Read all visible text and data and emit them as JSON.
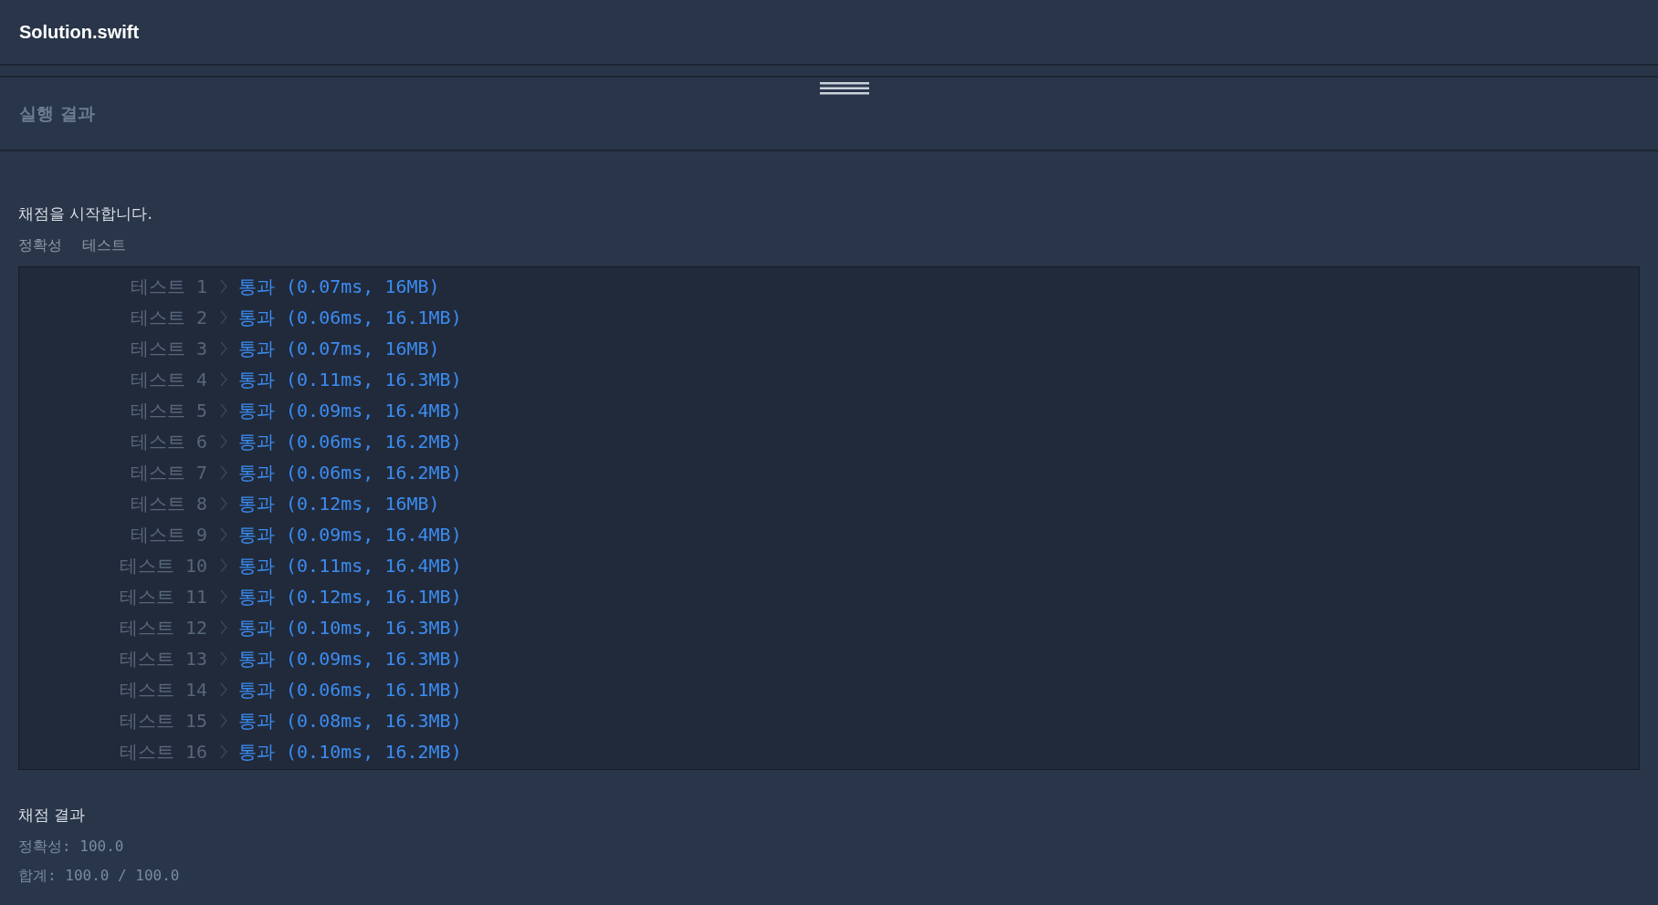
{
  "editor_tab": {
    "title": "Solution.swift"
  },
  "output_panel": {
    "title": "실행 결과"
  },
  "console": {
    "start_message": "채점을 시작합니다.",
    "section_title": [
      "정확성",
      "테스트"
    ],
    "tests": [
      {
        "label": "테스트 1",
        "passed": true,
        "result": "통과 (0.07ms, 16MB)"
      },
      {
        "label": "테스트 2",
        "passed": true,
        "result": "통과 (0.06ms, 16.1MB)"
      },
      {
        "label": "테스트 3",
        "passed": true,
        "result": "통과 (0.07ms, 16MB)"
      },
      {
        "label": "테스트 4",
        "passed": true,
        "result": "통과 (0.11ms, 16.3MB)"
      },
      {
        "label": "테스트 5",
        "passed": true,
        "result": "통과 (0.09ms, 16.4MB)"
      },
      {
        "label": "테스트 6",
        "passed": true,
        "result": "통과 (0.06ms, 16.2MB)"
      },
      {
        "label": "테스트 7",
        "passed": true,
        "result": "통과 (0.06ms, 16.2MB)"
      },
      {
        "label": "테스트 8",
        "passed": true,
        "result": "통과 (0.12ms, 16MB)"
      },
      {
        "label": "테스트 9",
        "passed": true,
        "result": "통과 (0.09ms, 16.4MB)"
      },
      {
        "label": "테스트 10",
        "passed": true,
        "result": "통과 (0.11ms, 16.4MB)"
      },
      {
        "label": "테스트 11",
        "passed": true,
        "result": "통과 (0.12ms, 16.1MB)"
      },
      {
        "label": "테스트 12",
        "passed": true,
        "result": "통과 (0.10ms, 16.3MB)"
      },
      {
        "label": "테스트 13",
        "passed": true,
        "result": "통과 (0.09ms, 16.3MB)"
      },
      {
        "label": "테스트 14",
        "passed": true,
        "result": "통과 (0.06ms, 16.1MB)"
      },
      {
        "label": "테스트 15",
        "passed": true,
        "result": "통과 (0.08ms, 16.3MB)"
      },
      {
        "label": "테스트 16",
        "passed": true,
        "result": "통과 (0.10ms, 16.2MB)"
      }
    ],
    "summary_title": "채점 결과",
    "summary_lines": [
      "정확성: 100.0",
      "합계: 100.0 / 100.0"
    ]
  }
}
